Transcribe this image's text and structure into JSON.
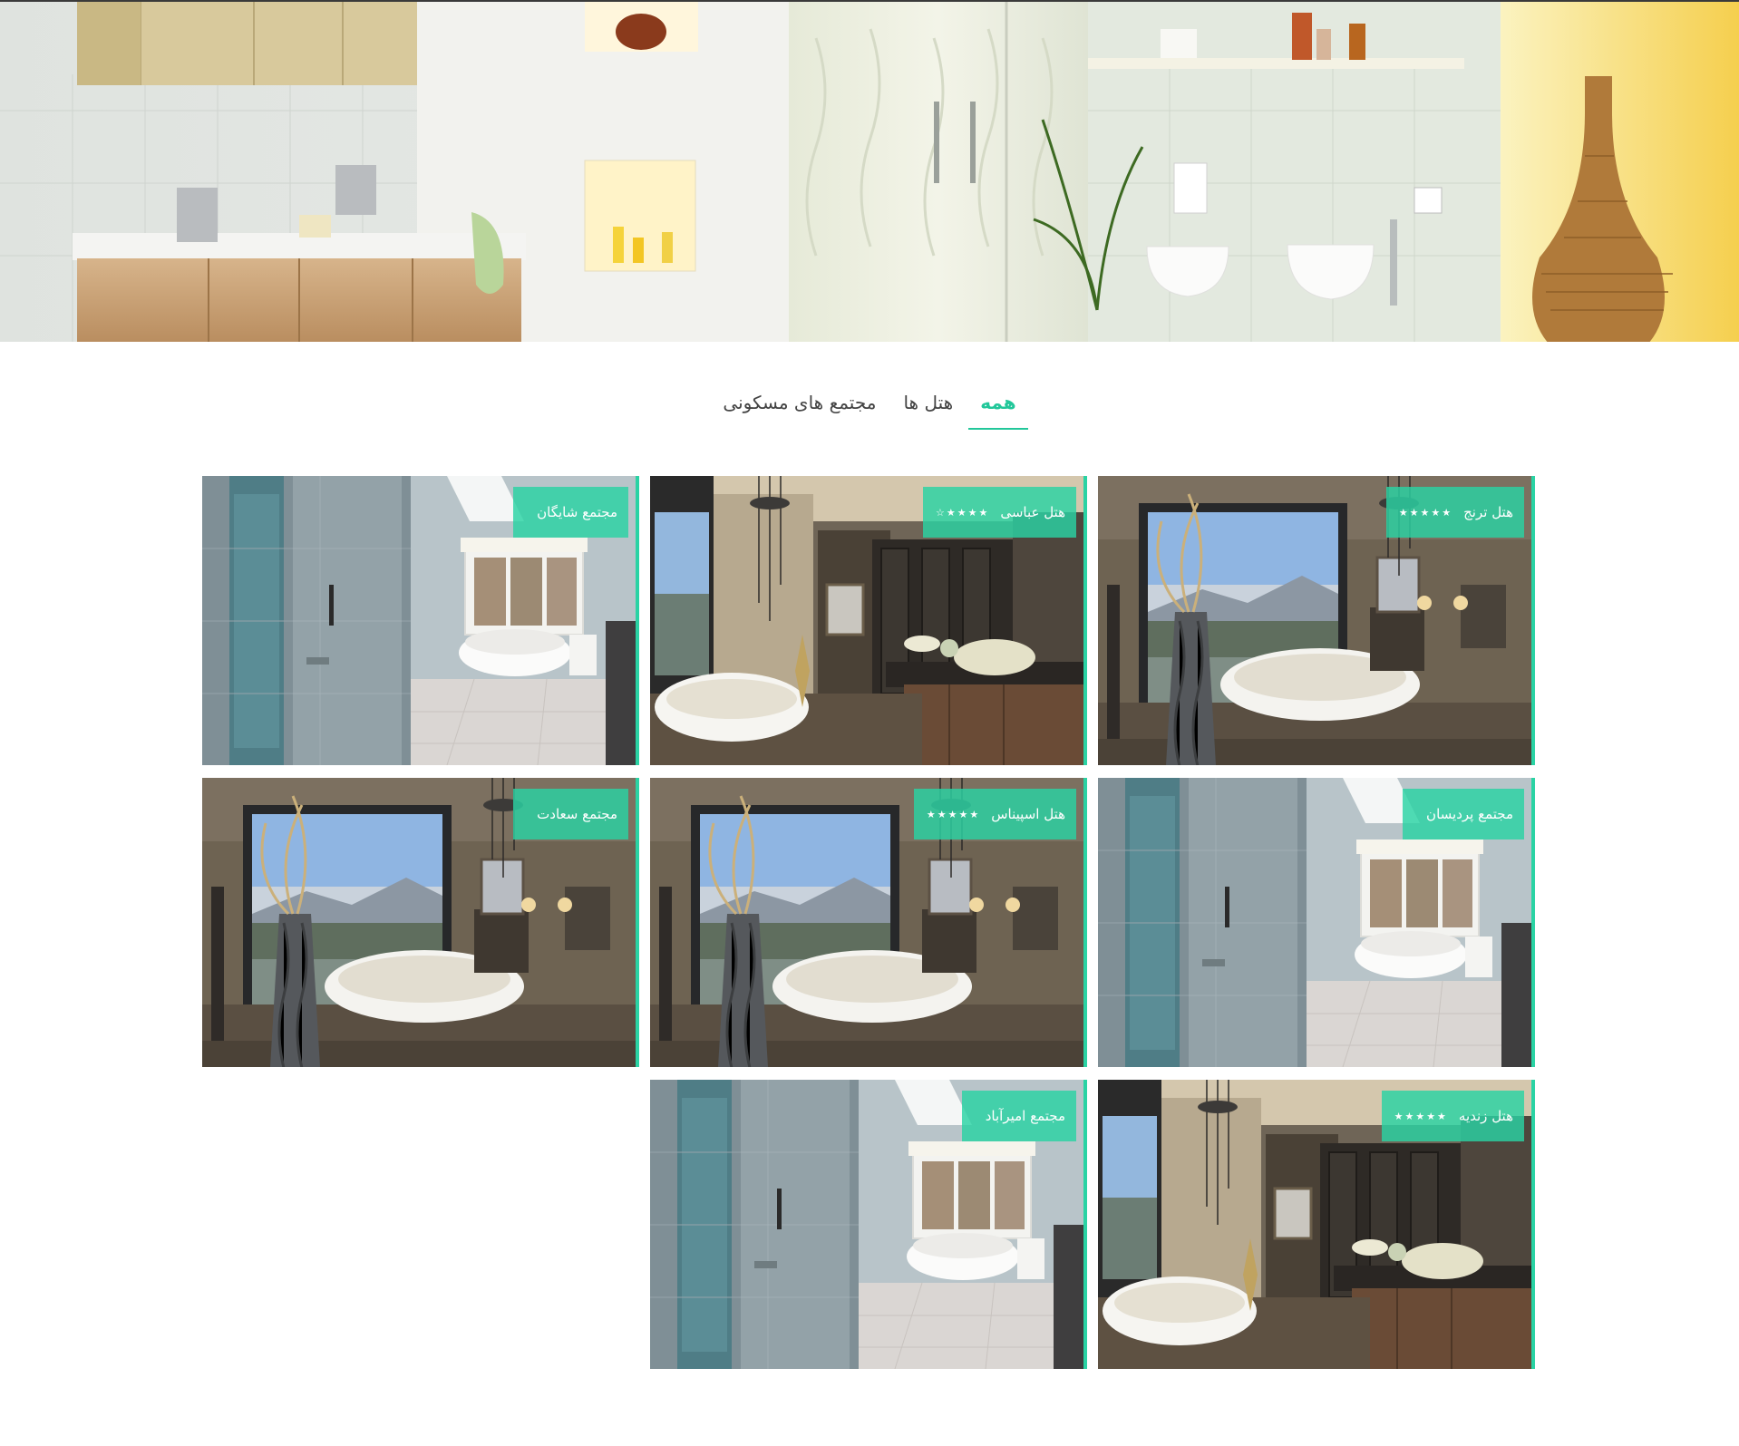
{
  "tabs": [
    {
      "label": "همه",
      "active": true
    },
    {
      "label": "هتل ها",
      "active": false
    },
    {
      "label": "مجتمع های مسکونی",
      "active": false
    }
  ],
  "accent_color": "#22c79a",
  "cards": [
    {
      "name": "هتل ترنج",
      "stars": "★★★★★",
      "scene": "window-bath"
    },
    {
      "name": "هتل عباسی",
      "stars": "★★★★☆",
      "scene": "vanity-bath"
    },
    {
      "name": "مجتمع شایگان",
      "stars": "",
      "scene": "shower-bath"
    },
    {
      "name": "مجتمع پردیسان",
      "stars": "",
      "scene": "shower-bath"
    },
    {
      "name": "هتل اسپیناس",
      "stars": "★★★★★",
      "scene": "window-bath"
    },
    {
      "name": "مجتمع سعادت",
      "stars": "",
      "scene": "window-bath"
    },
    {
      "name": "هتل زندیه",
      "stars": "★★★★★",
      "scene": "vanity-bath"
    },
    {
      "name": "مجتمع امیرآباد",
      "stars": "",
      "scene": "shower-bath"
    }
  ]
}
